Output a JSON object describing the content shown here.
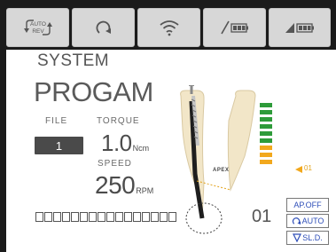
{
  "toolbar": {
    "buttons": [
      {
        "name": "auto-reverse",
        "icon": "auto-reverse-icon",
        "label_top": "AUTO",
        "label_bottom": "REV"
      },
      {
        "name": "rotation",
        "icon": "rotate-cw-icon"
      },
      {
        "name": "wireless",
        "icon": "wifi-icon"
      },
      {
        "name": "handpiece-battery",
        "icon": "handpiece-battery-icon"
      },
      {
        "name": "base-battery",
        "icon": "base-battery-icon"
      }
    ]
  },
  "main": {
    "system_label": "SYSTEM",
    "program_title": "PROGAM",
    "file": {
      "label": "FILE",
      "value": "1"
    },
    "torque": {
      "label": "TORQUE",
      "value": "1.0",
      "unit": "Ncm"
    },
    "speed": {
      "label": "SPEED",
      "value": "250",
      "unit": "RPM"
    },
    "progress_squares": 16,
    "apex": {
      "label": "APEX",
      "marker_label": "01",
      "number": "01",
      "bar_colors": {
        "green": "#2e9b3a",
        "orange": "#f2a81d"
      },
      "green_bars": 6,
      "orange_bars": 3
    },
    "modes": {
      "ap_off": "AP.OFF",
      "auto": "AUTO",
      "sl_d": "SL.D."
    }
  },
  "colors": {
    "background": "#1b1b1b",
    "toolbar_button": "#d7d7d7",
    "panel": "#ffffff",
    "accent_blue": "#2e4eb8"
  }
}
